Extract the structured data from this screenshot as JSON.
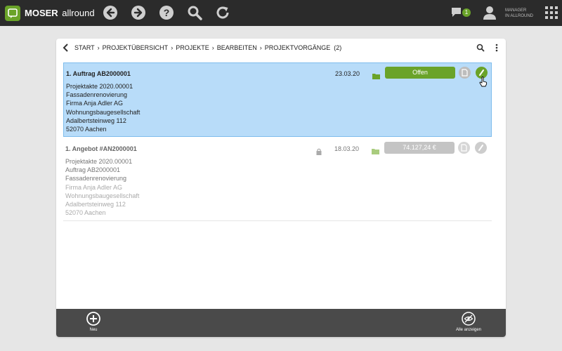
{
  "app": {
    "brand_bold": "MOSER",
    "brand_light": "allround",
    "message_count": "1",
    "user_role": "MANAGER",
    "user_scope": "IN ALLROUND"
  },
  "colors": {
    "accent": "#6aa329",
    "topbar": "#2b2b2b",
    "selected_row": "#b8dcf9",
    "bottombar": "#4a4a4a"
  },
  "toolbar": {
    "icons": [
      "back-icon",
      "forward-icon",
      "help-icon",
      "search-icon",
      "refresh-icon",
      "messages-icon",
      "user-icon",
      "apps-grid-icon"
    ]
  },
  "breadcrumb": {
    "items": [
      "START",
      "PROJEKTÜBERSICHT",
      "PROJEKTE",
      "BEARBEITEN",
      "PROJEKTVORGÄNGE"
    ],
    "count": "(2)",
    "separator": "›"
  },
  "rows": [
    {
      "title": "1. Auftrag AB2000001",
      "date": "23.03.20",
      "status": "Offen",
      "lines": [
        "Projektakte 2020.00001",
        "Fassadenrenovierung",
        "Firma Anja Adler AG",
        "Wohnungsbaugesellschaft",
        "Adalbertsteinweg 112",
        "52070 Aachen"
      ]
    },
    {
      "title": "1. Angebot #AN2000001",
      "date": "18.03.20",
      "status": "74.127,24 €",
      "lines": [
        "Projektakte 2020.00001",
        "Auftrag AB2000001",
        "Fassadenrenovierung",
        "Firma Anja Adler AG",
        "Wohnungsbaugesellschaft",
        "Adalbertsteinweg 112",
        "52070 Aachen"
      ]
    }
  ],
  "bottom": {
    "new_label": "Neu",
    "show_all_label": "Alle anzeigen"
  }
}
